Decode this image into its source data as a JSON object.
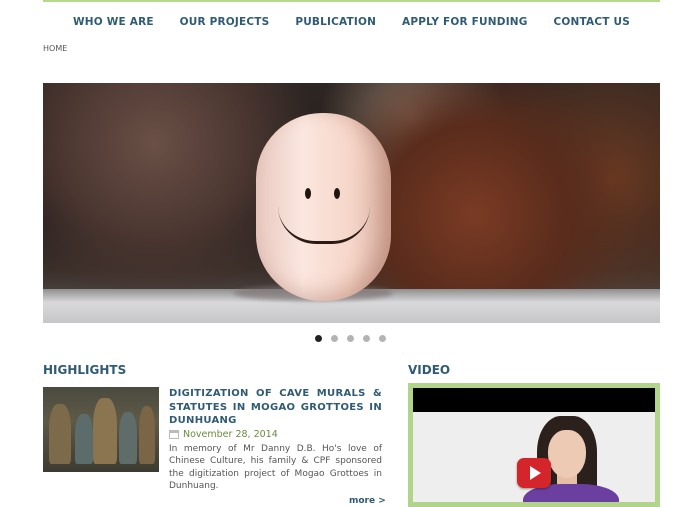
{
  "nav": {
    "items": [
      {
        "label": "WHO WE ARE"
      },
      {
        "label": "OUR PROJECTS"
      },
      {
        "label": "PUBLICATION"
      },
      {
        "label": "APPLY FOR FUNDING"
      },
      {
        "label": "CONTACT US"
      }
    ]
  },
  "breadcrumb": {
    "home": "HOME"
  },
  "slider": {
    "active_index": 0,
    "slide_count": 5
  },
  "highlights": {
    "title": "HIGHLIGHTS",
    "article": {
      "title": "DIGITIZATION OF CAVE MURALS & STATUTES IN MOGAO GROTTOES IN DUNHUANG",
      "date": "November 28, 2014",
      "body": "In memory of Mr Danny D.B. Ho's love of Chinese Culture, his family & CPF sponsored the digitization project of Mogao Grottoes in Dunhuang.",
      "more": "more >"
    }
  },
  "video": {
    "title": "VIDEO"
  },
  "colors": {
    "nav_text": "#2f5b74",
    "accent_green": "#b1d48a",
    "date_green": "#6b8c3f",
    "play_red": "#d4252a"
  }
}
